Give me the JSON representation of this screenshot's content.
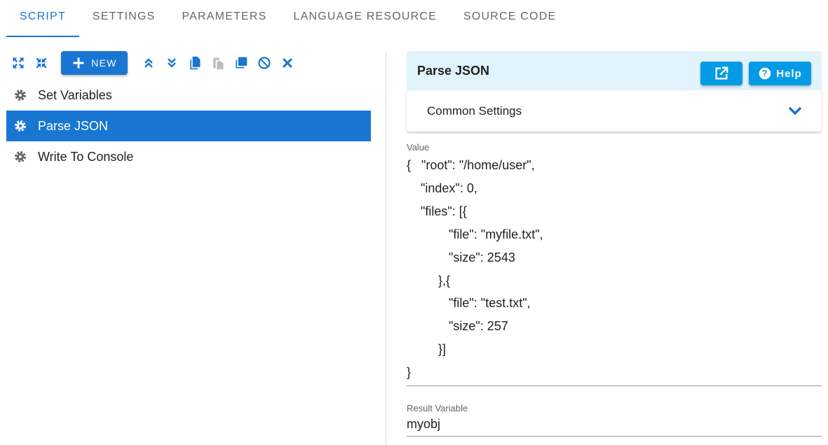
{
  "tabs": [
    "SCRIPT",
    "SETTINGS",
    "PARAMETERS",
    "LANGUAGE RESOURCE",
    "SOURCE CODE"
  ],
  "toolbar": {
    "new_label": "NEW",
    "icons": [
      "expand-icon",
      "collapse-icon",
      "move-up-icon",
      "move-down-icon",
      "copy-icon",
      "paste-icon",
      "duplicate-icon",
      "disable-icon",
      "delete-icon"
    ]
  },
  "items": [
    {
      "label": "Set Variables"
    },
    {
      "label": "Parse JSON"
    },
    {
      "label": "Write To Console"
    }
  ],
  "panel": {
    "title": "Parse JSON",
    "help_label": "Help",
    "common_settings": "Common Settings",
    "value_label": "Value",
    "value_lines": [
      "{   \"root\": \"/home/user\",",
      "    \"index\": 0,",
      "    \"files\": [{",
      "            \"file\": \"myfile.txt\",",
      "            \"size\": 2543",
      "         },{",
      "            \"file\": \"test.txt\",",
      "            \"size\": 257",
      "         }]",
      "}"
    ],
    "result_label": "Result Variable",
    "result_value": "myobj"
  },
  "colors": {
    "primary": "#1976d2",
    "header_bg": "#e1f4fc",
    "header_button": "#039be5"
  }
}
